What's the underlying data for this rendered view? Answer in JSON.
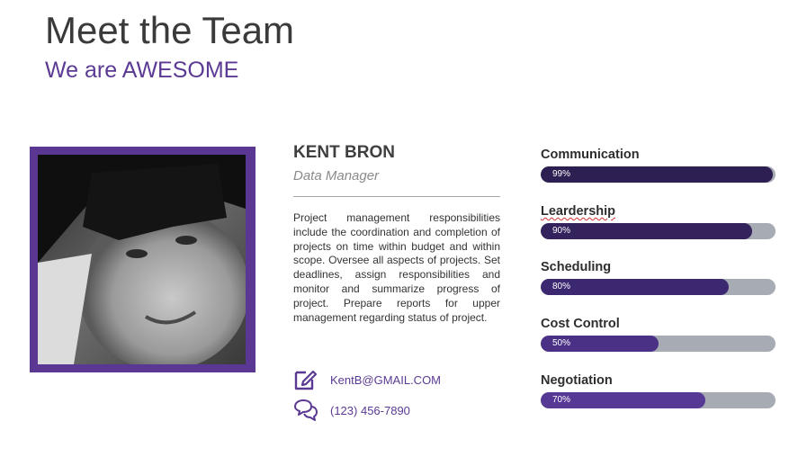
{
  "header": {
    "title": "Meet the Team",
    "subtitle": "We are AWESOME"
  },
  "profile": {
    "name": "KENT BRON",
    "role": "Data Manager",
    "bio": "Project management responsibilities include the coordination and completion of projects on time within budget and within scope. Oversee all aspects of projects. Set deadlines, assign responsibilities and monitor and summarize progress of project. Prepare reports for upper management regarding  status of project.",
    "photo": "portrait-photo",
    "email": "KentB@GMAIL.COM",
    "email_icon": "edit-icon",
    "phone": "(123)  456-7890",
    "phone_icon": "chat-bubbles-icon"
  },
  "skills": [
    {
      "label": "Communication",
      "percent_text": "99%",
      "value": 0.99,
      "color": "#2e1f52"
    },
    {
      "label": "Leardership",
      "percent_text": "90%",
      "value": 0.9,
      "color": "#33225c"
    },
    {
      "label": "Scheduling",
      "percent_text": "80%",
      "value": 0.8,
      "color": "#3c2870"
    },
    {
      "label": "Cost Control",
      "percent_text": "50%",
      "value": 0.5,
      "color": "#4a3186"
    },
    {
      "label": "Negotiation",
      "percent_text": "70%",
      "value": 0.7,
      "color": "#563895"
    }
  ],
  "colors": {
    "accent": "#5b3794",
    "track": "#a7acb4"
  }
}
